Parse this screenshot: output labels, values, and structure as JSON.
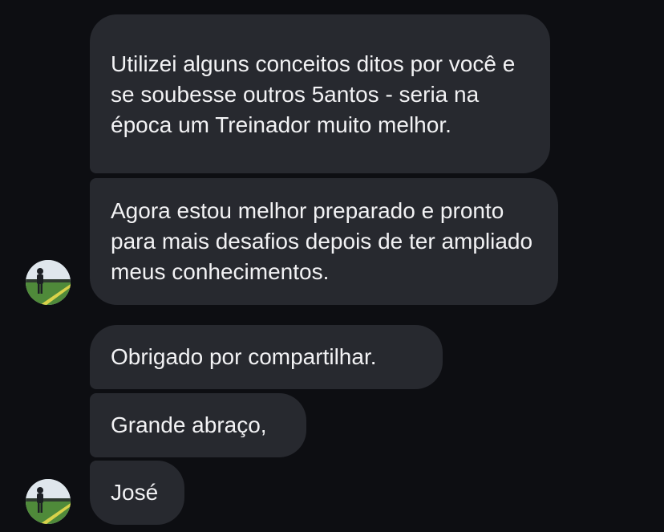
{
  "chat": {
    "messages": [
      {
        "text": "Utilizei alguns conceitos ditos por você e se soubesse outros 5antos - seria na época um Treinador muito melhor."
      },
      {
        "text": "Agora estou melhor preparado e pronto para mais desafios depois de ter ampliado meus conhecimentos."
      },
      {
        "text": "Obrigado por compartilhar."
      },
      {
        "text": "Grande abraço,"
      },
      {
        "text": "José"
      }
    ]
  },
  "avatar": {
    "icon": "profile-photo-soccer-field"
  },
  "colors": {
    "background": "#0d0e12",
    "bubble": "#27292f",
    "text": "#f2f2f4"
  }
}
